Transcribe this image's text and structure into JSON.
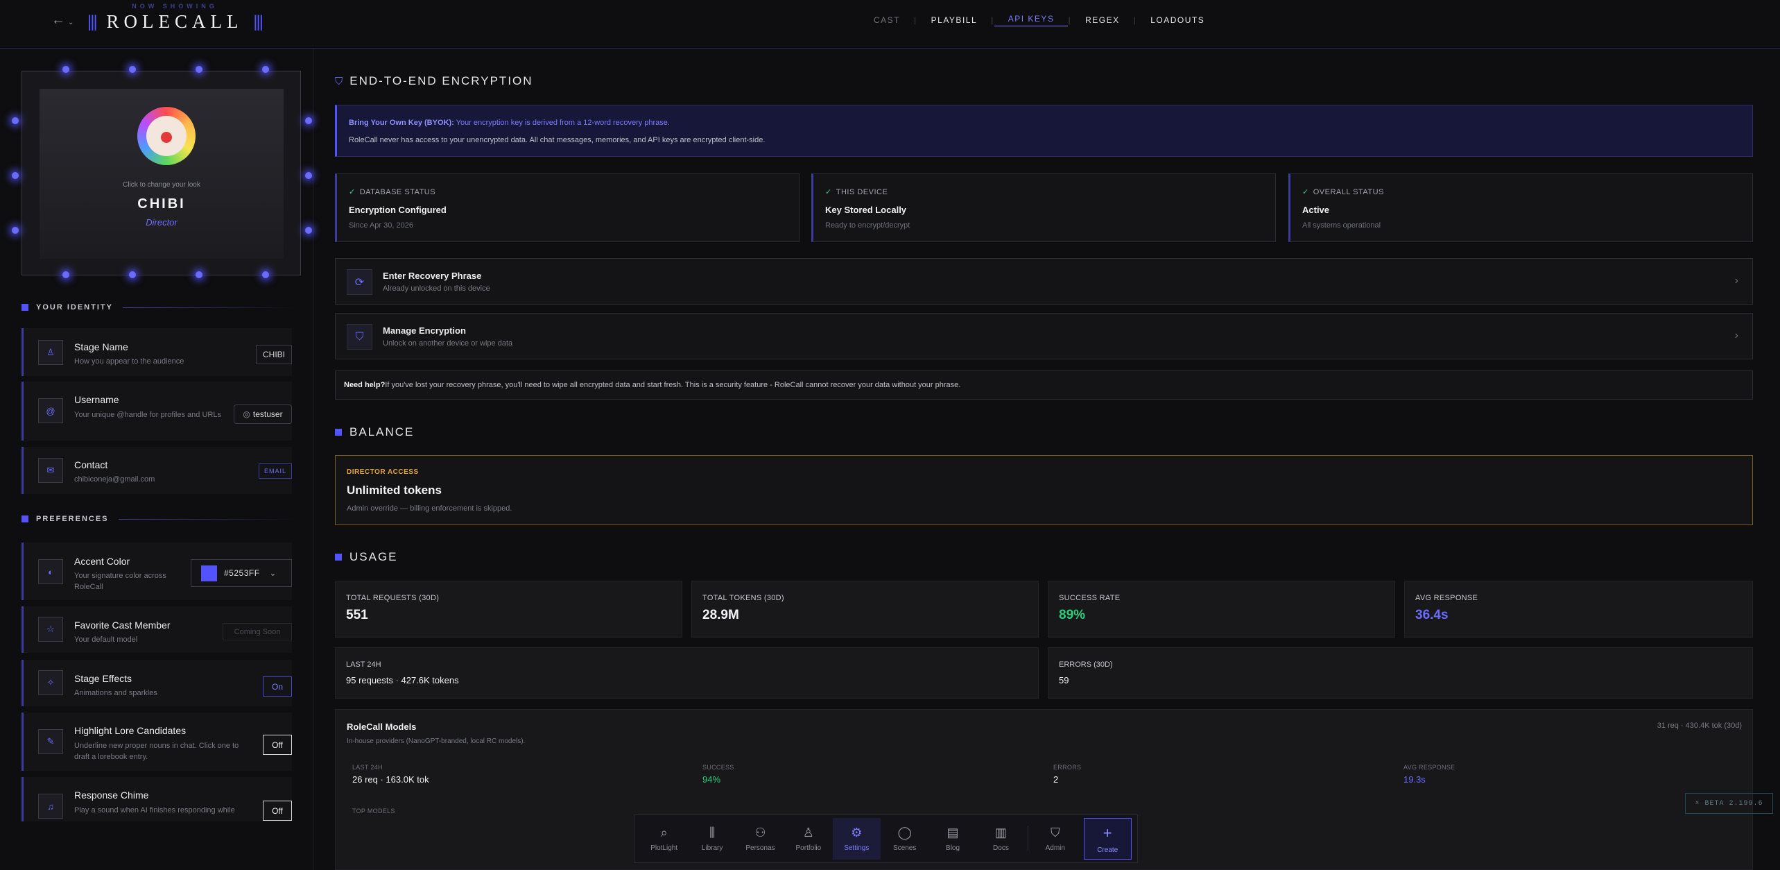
{
  "header": {
    "back_icon": "arrow-left-icon",
    "logo_tagline": "NOW SHOWING",
    "logo_name": "ROLECALL",
    "tabs": [
      {
        "label": "CAST"
      },
      {
        "label": "PLAYBILL"
      },
      {
        "label": "API KEYS"
      },
      {
        "label": "REGEX"
      },
      {
        "label": "LOADOUTS"
      }
    ],
    "active_tab": "API KEYS"
  },
  "profile": {
    "click_hint": "Click to change your look",
    "name": "CHIBI",
    "role": "Director"
  },
  "identity": {
    "heading": "YOUR IDENTITY",
    "stage_name": {
      "label": "Stage Name",
      "sub": "How you appear to the audience",
      "value": "CHIBI"
    },
    "username": {
      "label": "Username",
      "sub": "Your unique @handle for profiles and URLs",
      "value": "testuser"
    },
    "contact": {
      "label": "Contact",
      "sub": "chibiconeja@gmail.com",
      "badge": "EMAIL"
    }
  },
  "preferences": {
    "heading": "PREFERENCES",
    "accent": {
      "label": "Accent Color",
      "sub": "Your signature color across RoleCall",
      "value": "#5253FF",
      "swatch": "#5253FF"
    },
    "favorite": {
      "label": "Favorite Cast Member",
      "sub": "Your default model",
      "value": "Coming Soon"
    },
    "effects": {
      "label": "Stage Effects",
      "sub": "Animations and sparkles",
      "value": "On"
    },
    "lore": {
      "label": "Highlight Lore Candidates",
      "sub": "Underline new proper nouns in chat. Click one to draft a lorebook entry.",
      "value": "Off"
    },
    "chime": {
      "label": "Response Chime",
      "sub": "Play a sound when AI finishes responding while",
      "value": "Off"
    }
  },
  "encryption": {
    "title": "END-TO-END ENCRYPTION",
    "byok_bold": "Bring Your Own Key (BYOK):",
    "byok_text": "Your encryption key is derived from a 12-word recovery phrase.",
    "byok_note": "RoleCall never has access to your unencrypted data. All chat messages, memories, and API keys are encrypted client-side.",
    "statuses": [
      {
        "label": "DATABASE STATUS",
        "value": "Encryption Configured",
        "sub": "Since Apr 30, 2026"
      },
      {
        "label": "THIS DEVICE",
        "value": "Key Stored Locally",
        "sub": "Ready to encrypt/decrypt"
      },
      {
        "label": "OVERALL STATUS",
        "value": "Active",
        "sub": "All systems operational"
      }
    ],
    "recovery": {
      "title": "Enter Recovery Phrase",
      "sub": "Already unlocked on this device"
    },
    "manage": {
      "title": "Manage Encryption",
      "sub": "Unlock on another device or wipe data"
    },
    "help_bold": "Need help?",
    "help_text": "If you've lost your recovery phrase, you'll need to wipe all encrypted data and start fresh. This is a security feature - RoleCall cannot recover your data without your phrase."
  },
  "balance": {
    "title": "BALANCE",
    "access": "DIRECTOR ACCESS",
    "value": "Unlimited tokens",
    "note": "Admin override — billing enforcement is skipped."
  },
  "usage": {
    "title": "USAGE",
    "cards": [
      {
        "label": "TOTAL REQUESTS (30D)",
        "value": "551"
      },
      {
        "label": "TOTAL TOKENS (30D)",
        "value": "28.9M"
      },
      {
        "label": "SUCCESS RATE",
        "value": "89%"
      },
      {
        "label": "AVG RESPONSE",
        "value": "36.4s"
      }
    ],
    "last24": {
      "label": "LAST 24H",
      "value": "95 requests · 427.6K tokens"
    },
    "errors": {
      "label": "ERRORS (30D)",
      "value": "59"
    },
    "models": {
      "title": "RoleCall Models",
      "sub": "In-house providers (NanoGPT-branded, local RC models).",
      "summary": "31 req · 430.4K tok (30d)",
      "last24_label": "LAST 24H",
      "last24_value": "26 req · 163.0K tok",
      "success_label": "SUCCESS",
      "success_value": "94%",
      "errors_label": "ERRORS",
      "errors_value": "2",
      "avg_label": "AVG RESPONSE",
      "avg_value": "19.3s",
      "top_label": "TOP MODELS"
    }
  },
  "dock": [
    {
      "label": "PlotLight",
      "icon": "search-icon"
    },
    {
      "label": "Library",
      "icon": "library-icon"
    },
    {
      "label": "Personas",
      "icon": "people-icon"
    },
    {
      "label": "Portfolio",
      "icon": "person-icon"
    },
    {
      "label": "Settings",
      "icon": "gear-icon"
    },
    {
      "label": "Scenes",
      "icon": "chat-bubble-icon"
    },
    {
      "label": "Blog",
      "icon": "book-icon"
    },
    {
      "label": "Docs",
      "icon": "scroll-icon"
    },
    {
      "label": "Admin",
      "icon": "shield-icon"
    },
    {
      "label": "Create",
      "icon": "plus-icon"
    }
  ],
  "beta": "× BETA 2.199.6",
  "colors": {
    "accent": "#5253FF",
    "success": "#27D07A",
    "warning": "#E6A42A",
    "background": "#0E0E10"
  }
}
